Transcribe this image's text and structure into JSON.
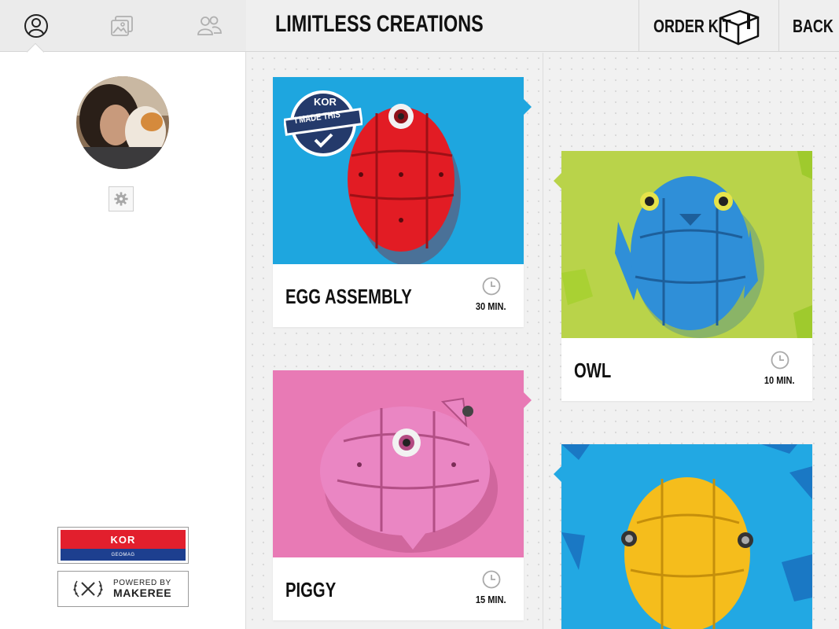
{
  "sidebar": {
    "tabs": [
      {
        "icon": "profile-icon",
        "active": true
      },
      {
        "icon": "gallery-icon",
        "active": false
      },
      {
        "icon": "community-icon",
        "active": false
      }
    ],
    "settings_icon": "gear-icon",
    "badges": {
      "kor_logo": "KOR",
      "kor_sub": "GEOMAG",
      "powered_small": "POWERED BY",
      "powered_brand": "MAKEREE"
    }
  },
  "header": {
    "title": "LIMITLESS CREATIONS",
    "order_kit_label": "ORDER KIT",
    "back_label": "BACK"
  },
  "cards": [
    {
      "name": "EGG ASSEMBLY",
      "duration": "30 MIN.",
      "bg": "#1ea6df",
      "toy": "#e21c24",
      "stamp": "I MADE THIS",
      "stamp_logo": "KOR"
    },
    {
      "name": "OWL",
      "duration": "10 MIN.",
      "bg": "#b9d34a",
      "toy": "#2f8fd8"
    },
    {
      "name": "PIGGY",
      "duration": "15 MIN.",
      "bg": "#e87ab5",
      "toy": "#ea86c3"
    },
    {
      "name": "",
      "duration": "",
      "bg": "#22a8e3",
      "toy": "#f5bd1c"
    }
  ],
  "colors": {
    "header_bg": "#efefef",
    "sidebar_bg": "#ffffff",
    "content_bg": "#f1f1f1",
    "text": "#111111"
  }
}
